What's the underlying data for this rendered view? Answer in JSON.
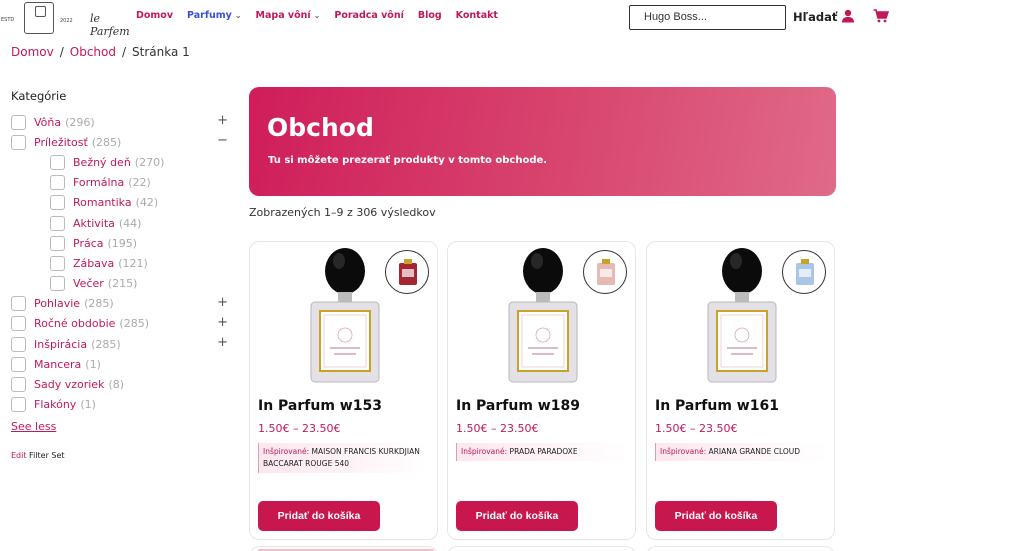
{
  "brand": {
    "year_left": "ESTD",
    "year_right": "2022",
    "script": "le Parfem"
  },
  "nav": [
    {
      "label": "Domov",
      "active": false,
      "dropdown": false
    },
    {
      "label": "Parfumy",
      "active": true,
      "dropdown": true
    },
    {
      "label": "Mapa vôní",
      "active": false,
      "dropdown": true
    },
    {
      "label": "Poradca vôní",
      "active": false,
      "dropdown": false
    },
    {
      "label": "Blog",
      "active": false,
      "dropdown": false
    },
    {
      "label": "Kontakt",
      "active": false,
      "dropdown": false
    }
  ],
  "search": {
    "value": "Hugo Boss...",
    "button": "Hľadať"
  },
  "icons": {
    "user": "user-icon",
    "cart": "cart-icon"
  },
  "breadcrumb": {
    "home": "Domov",
    "shop": "Obchod",
    "current": "Stránka 1",
    "sep": "/"
  },
  "sidebar": {
    "title": "Kategórie",
    "categories": [
      {
        "label": "Vôňa",
        "count": "(296)",
        "toggle": "+",
        "sub": false
      },
      {
        "label": "Príležitosť",
        "count": "(285)",
        "toggle": "−",
        "sub": false
      },
      {
        "label": "Bežný deň",
        "count": "(270)",
        "toggle": "",
        "sub": true
      },
      {
        "label": "Formálna",
        "count": "(22)",
        "toggle": "",
        "sub": true
      },
      {
        "label": "Romantika",
        "count": "(42)",
        "toggle": "",
        "sub": true
      },
      {
        "label": "Aktivita",
        "count": "(44)",
        "toggle": "",
        "sub": true
      },
      {
        "label": "Práca",
        "count": "(195)",
        "toggle": "",
        "sub": true
      },
      {
        "label": "Zábava",
        "count": "(121)",
        "toggle": "",
        "sub": true
      },
      {
        "label": "Večer",
        "count": "(215)",
        "toggle": "",
        "sub": true
      },
      {
        "label": "Pohlavie",
        "count": "(285)",
        "toggle": "+",
        "sub": false
      },
      {
        "label": "Ročné obdobie",
        "count": "(285)",
        "toggle": "+",
        "sub": false
      },
      {
        "label": "Inšpirácia",
        "count": "(285)",
        "toggle": "+",
        "sub": false
      },
      {
        "label": "Mancera",
        "count": "(1)",
        "toggle": "",
        "sub": false
      },
      {
        "label": "Sady vzoriek",
        "count": "(8)",
        "toggle": "",
        "sub": false
      },
      {
        "label": "Flakóny",
        "count": "(1)",
        "toggle": "",
        "sub": false
      }
    ],
    "see_less": "See less",
    "edit": "Edit",
    "filter_set": "Filter Set"
  },
  "hero": {
    "title": "Obchod",
    "subtitle": "Tu si môžete prezerať produkty v tomto obchode."
  },
  "results": "Zobrazených 1–9 z 306 výsledkov",
  "products": [
    {
      "name": "In Parfum w153",
      "price": "1.50€ – 23.50€",
      "inspired_label": "Inšpirované:",
      "inspired_value": "MAISON FRANCIS KURKDJIAN BACCARAT ROUGE 540",
      "button": "Pridať do košíka",
      "thumb_color": "#a32632"
    },
    {
      "name": "In Parfum w189",
      "price": "1.50€ – 23.50€",
      "inspired_label": "Inšpirované:",
      "inspired_value": "PRADA PARADOXE",
      "button": "Pridať do košíka",
      "thumb_color": "#e7b9b3"
    },
    {
      "name": "In Parfum w161",
      "price": "1.50€ – 23.50€",
      "inspired_label": "Inšpirované:",
      "inspired_value": "ARIANA GRANDE CLOUD",
      "button": "Pridať do košíka",
      "thumb_color": "#a9c6e8"
    }
  ],
  "colors": {
    "accent": "#c2185b",
    "nav_active": "#3b4fd8",
    "button": "#c8174f"
  }
}
